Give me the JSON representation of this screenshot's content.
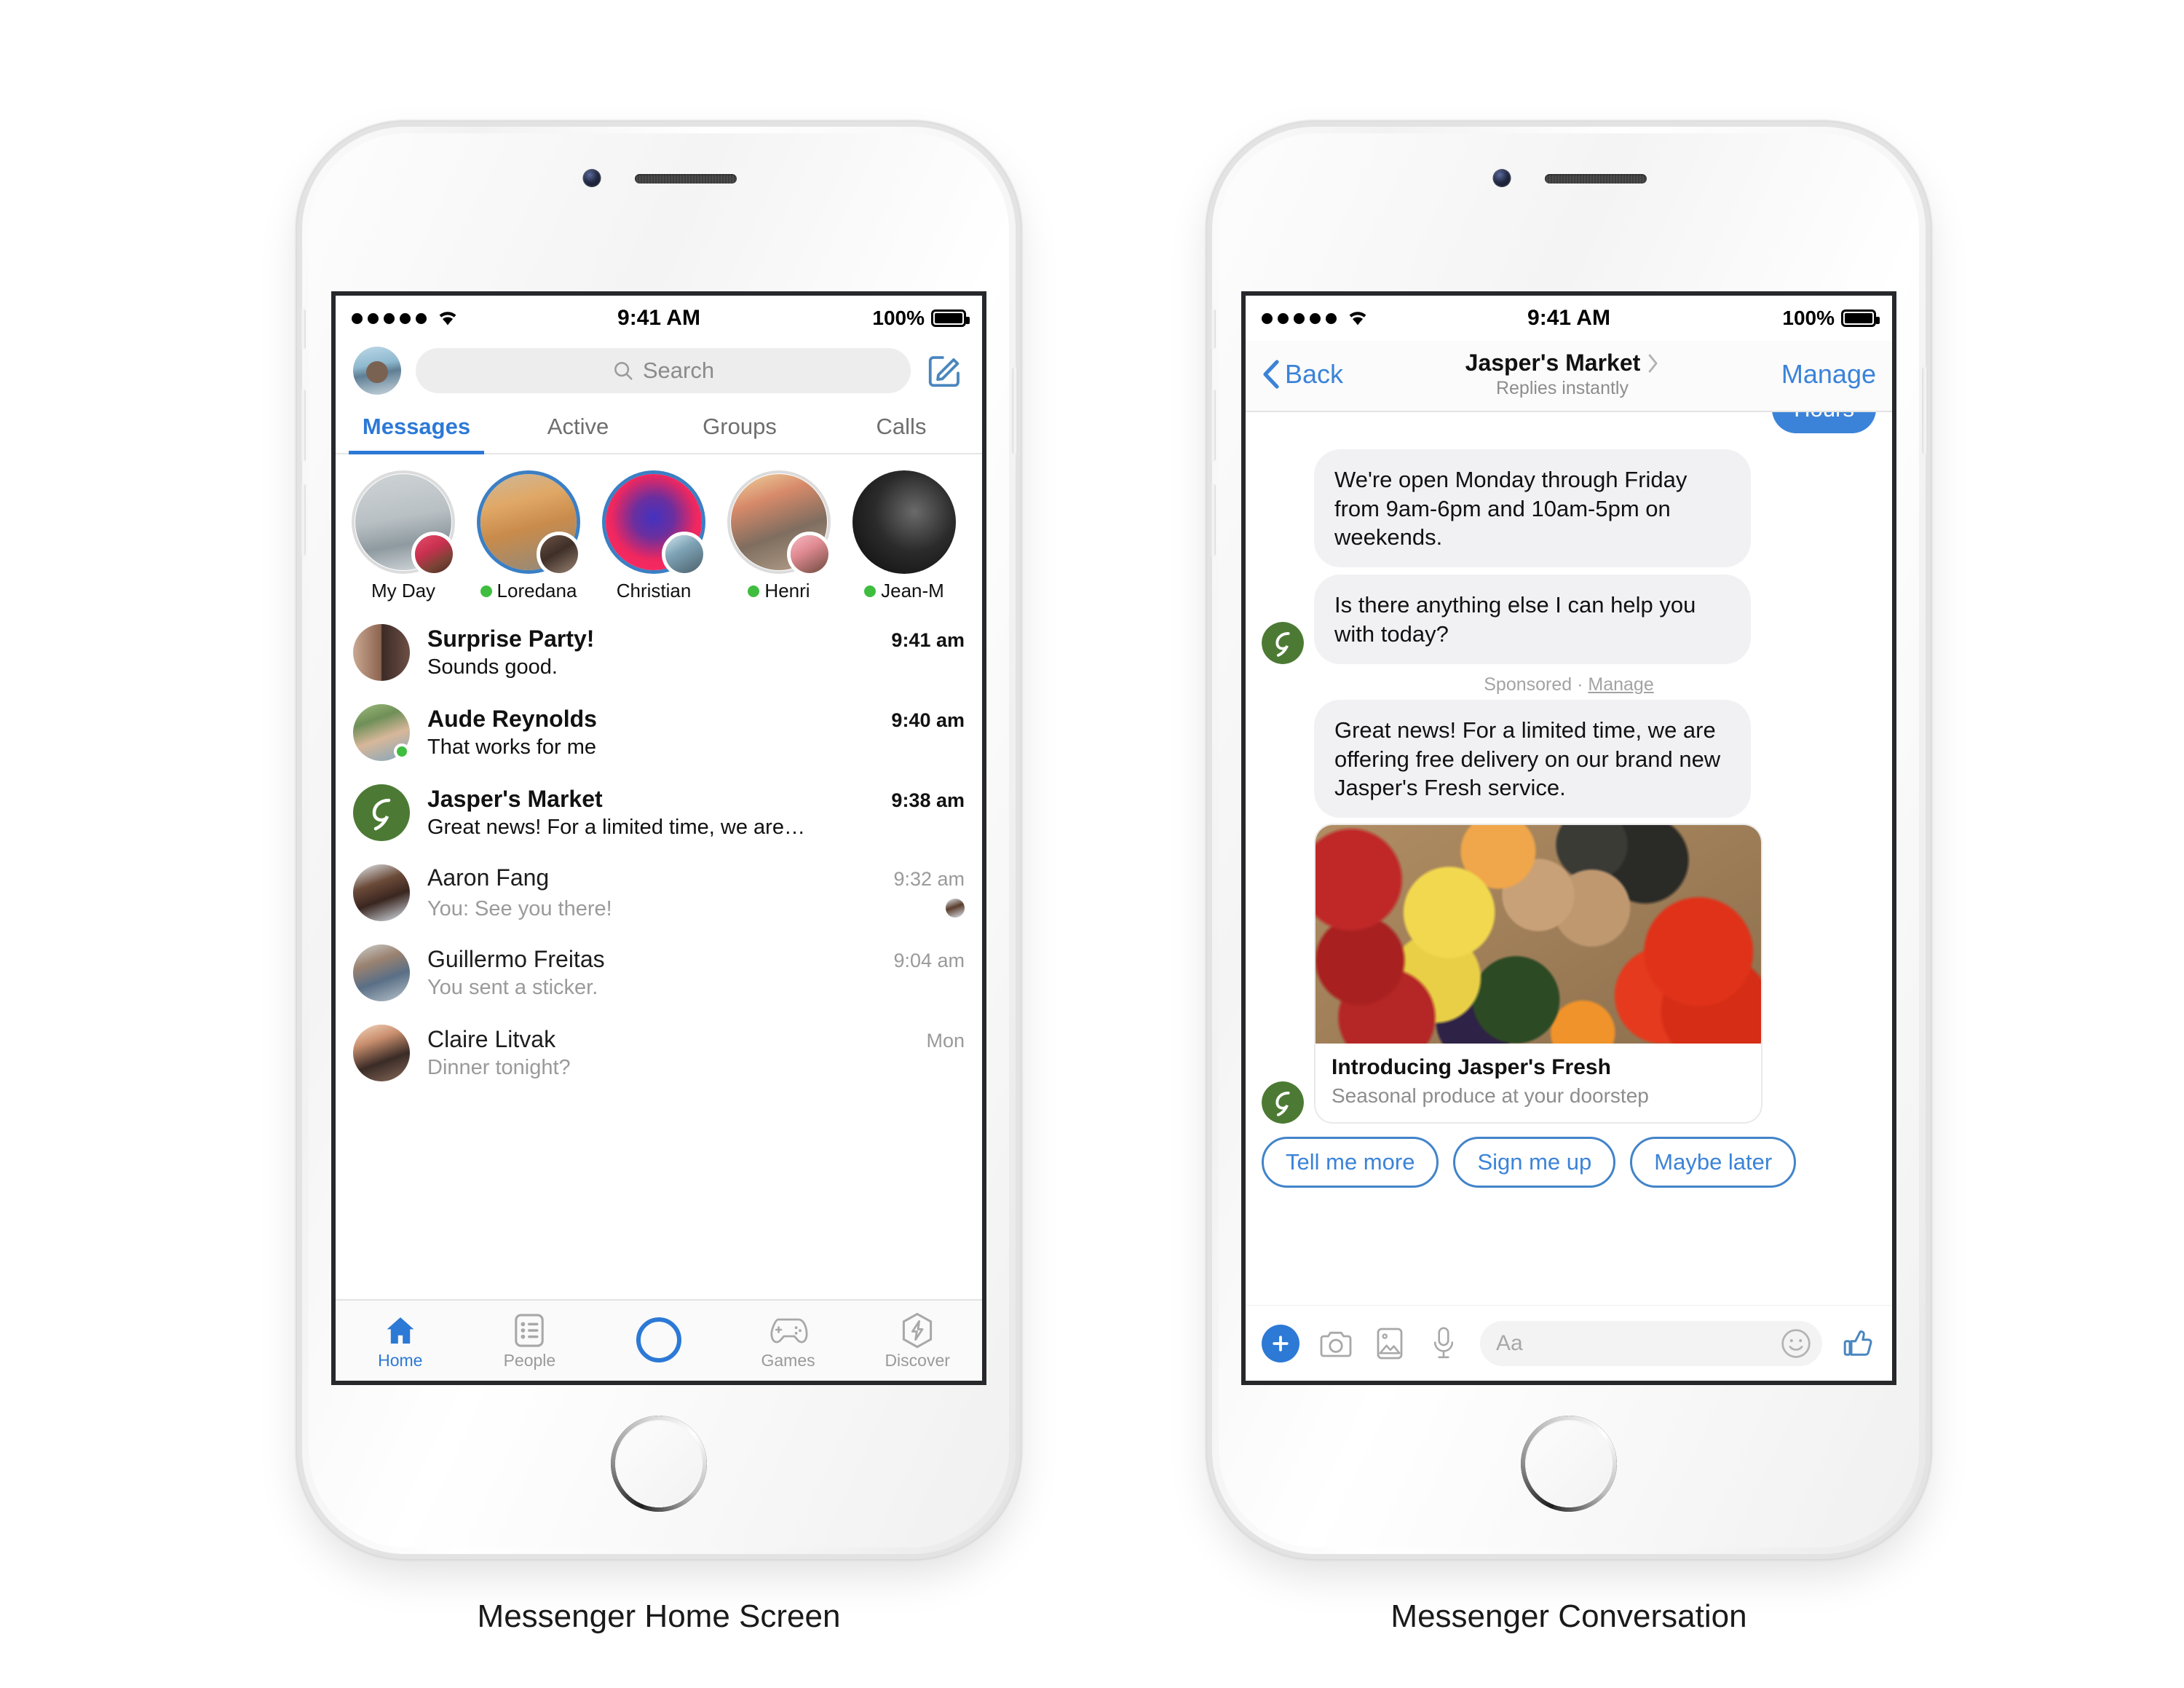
{
  "captions": {
    "left": "Messenger Home Screen",
    "right": "Messenger Conversation"
  },
  "status_bar": {
    "time": "9:41 AM",
    "battery": "100%",
    "signal_dots": 5,
    "wifi_icon": "wifi-icon"
  },
  "home_screen": {
    "search": {
      "placeholder": "Search",
      "icon": "search-icon"
    },
    "compose_icon": "compose-icon",
    "avatar": "user-avatar",
    "tabs": [
      {
        "label": "Messages",
        "active": true
      },
      {
        "label": "Active",
        "active": false
      },
      {
        "label": "Groups",
        "active": false
      },
      {
        "label": "Calls",
        "active": false
      }
    ],
    "stories": [
      {
        "name": "My Day",
        "online": false,
        "ring": "seen"
      },
      {
        "name": "Loredana",
        "online": true,
        "ring": "unread"
      },
      {
        "name": "Christian",
        "online": false,
        "ring": "unread"
      },
      {
        "name": "Henri",
        "online": true,
        "ring": "seen"
      },
      {
        "name": "Jean-M",
        "online": true,
        "ring": "plain"
      }
    ],
    "conversations": [
      {
        "name": "Surprise Party!",
        "preview": "Sounds good.",
        "time": "9:41 am",
        "unread": true,
        "online": false,
        "seen_by": false
      },
      {
        "name": "Aude Reynolds",
        "preview": "That works for me",
        "time": "9:40 am",
        "unread": true,
        "online": true,
        "seen_by": false
      },
      {
        "name": "Jasper's Market",
        "preview": "Great news! For a limited time, we are…",
        "time": "9:38 am",
        "unread": true,
        "online": false,
        "seen_by": false
      },
      {
        "name": "Aaron Fang",
        "preview": "You: See you there!",
        "time": "9:32 am",
        "unread": false,
        "online": false,
        "seen_by": true
      },
      {
        "name": "Guillermo Freitas",
        "preview": "You sent a sticker.",
        "time": "9:04 am",
        "unread": false,
        "online": false,
        "seen_by": false
      },
      {
        "name": "Claire Litvak",
        "preview": "Dinner tonight?",
        "time": "Mon",
        "unread": false,
        "online": false,
        "seen_by": false
      }
    ],
    "bottom_nav": [
      {
        "label": "Home",
        "icon": "home-icon",
        "active": true
      },
      {
        "label": "People",
        "icon": "people-list-icon",
        "active": false
      },
      {
        "label": "",
        "icon": "camera-shutter-icon",
        "active": false
      },
      {
        "label": "Games",
        "icon": "gamepad-icon",
        "active": false
      },
      {
        "label": "Discover",
        "icon": "lightning-bolt-icon",
        "active": false
      }
    ]
  },
  "conversation_screen": {
    "back_label": "Back",
    "back_icon": "chevron-left-icon",
    "title": "Jasper's Market",
    "title_chevron": "chevron-right-icon",
    "subtitle": "Replies instantly",
    "manage_label": "Manage",
    "messages": [
      {
        "side": "out",
        "text": "Hours"
      },
      {
        "side": "in",
        "text": "We're open Monday through Friday from 9am-6pm and 10am-5pm on weekends."
      },
      {
        "side": "in",
        "text": "Is there anything else I can help you with today?",
        "avatar": true
      }
    ],
    "sponsored_label": "Sponsored · ",
    "sponsored_link": "Manage",
    "ad_message": "Great news! For a limited time, we are offering free delivery on our brand new Jasper's Fresh service.",
    "ad_card": {
      "image": "fresh-produce-photo",
      "title": "Introducing Jasper's Fresh",
      "subtitle": "Seasonal produce at your doorstep"
    },
    "quick_replies": [
      "Tell me more",
      "Sign me up",
      "Maybe later"
    ],
    "composer": {
      "plus_icon": "plus-icon",
      "camera_icon": "camera-icon",
      "gallery_icon": "photo-gallery-icon",
      "mic_icon": "microphone-icon",
      "input_placeholder": "Aa",
      "emoji_icon": "smiley-icon",
      "like_icon": "thumbs-up-icon"
    }
  },
  "colors": {
    "accent_blue": "#2c79d6",
    "link_blue": "#3b83d8",
    "bubble_gray": "#f1f0f3",
    "online_green": "#3fbd3f",
    "jasper_green": "#4c7a34"
  }
}
